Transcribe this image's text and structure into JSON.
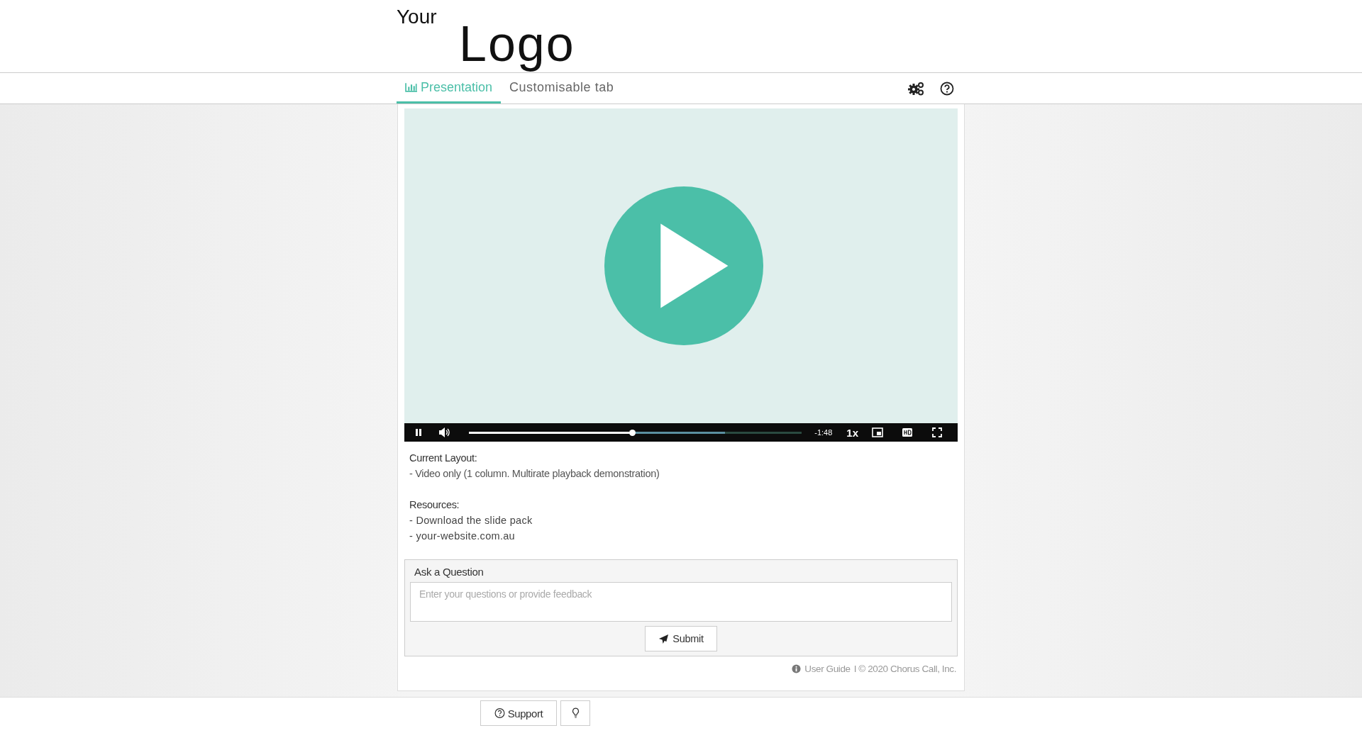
{
  "logo": {
    "top": "Your",
    "main": "Logo"
  },
  "tabs": [
    {
      "label": "Presentation",
      "selected": true,
      "kind": "chart"
    },
    {
      "label": "Customisable tab",
      "selected": false,
      "kind": "plain"
    }
  ],
  "player": {
    "progress": {
      "level": 0.49
    },
    "buffer": {
      "level": 0.77
    },
    "time": "-1:48",
    "rate": "1x"
  },
  "info": {
    "layout_heading": "Current Layout:",
    "layout_lines": [
      "- Video only (1 column. Multirate playback demonstration)"
    ],
    "resources_heading": "Resources:",
    "resources": [
      "- Download the slide pack",
      "- your-website.com.au"
    ]
  },
  "question": {
    "title": "Ask a Question",
    "placeholder": "Enter your questions or provide feedback",
    "submit": "Submit"
  },
  "footer_note": {
    "link": "User Guide",
    "text": "I © 2020 Chorus Call, Inc."
  },
  "bottom_buttons": [
    {
      "kind": "support",
      "label": "Support"
    },
    {
      "kind": "tip"
    }
  ]
}
